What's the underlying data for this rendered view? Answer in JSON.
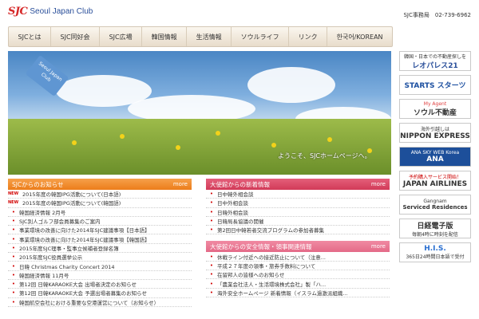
{
  "header": {
    "logo_mark": "SJC",
    "logo_text": "Seoul Japan Club",
    "office_label": "SJC事務局　02-739-6962"
  },
  "nav": {
    "items": [
      "SJCとは",
      "SJC同好会",
      "SJC広場",
      "韓国情報",
      "生活情報",
      "ソウルライフ",
      "リンク",
      "한국어/KOREAN"
    ]
  },
  "hero": {
    "tag_text": "Seoul Japan Club",
    "welcome_text": "ようこそ、SJCホームページへ。"
  },
  "sidebar": {
    "banners": [
      {
        "top": "韓国・日本での不動産探しを",
        "main": "レオパレス21"
      },
      {
        "top": "",
        "main": "STARTS スターツ"
      },
      {
        "top": "My Agent",
        "main": "ソウル不動産"
      },
      {
        "top": "海外引越しは",
        "main": "NIPPON EXPRESS"
      },
      {
        "top": "ANA SKY WEB Korea",
        "main": "ANA"
      },
      {
        "top": "予約購入サービス開始！",
        "main": "JAPAN AIRLINES"
      },
      {
        "top": "Gangnam",
        "main": "Serviced Residences"
      },
      {
        "top": "毎朝4時に時刻を配信",
        "main": "日経電子版"
      },
      {
        "top": "365日24時間日本語で受付",
        "main": "H.I.S."
      }
    ]
  },
  "sjc_news": {
    "title": "SJCからのお知らせ",
    "more": "more",
    "items": [
      {
        "new": "NEW",
        "text": "2015年度の韓国IPG活動について(日本語)"
      },
      {
        "new": "NEW",
        "text": "2015年度の韓国IPG活動について(韓国語)"
      },
      {
        "new": "",
        "text": "韓国経済情報 2月号"
      },
      {
        "new": "",
        "text": "SJC別人ゴルフ部会員募集のご案内"
      },
      {
        "new": "",
        "text": "事業環境の改善に向けた2014年SJC建議事項【日本語】"
      },
      {
        "new": "",
        "text": "事業環境の改善に向けた2014年SJC建議事項【韓国語】"
      },
      {
        "new": "",
        "text": "2015年度SJC理事・監事立候補者登録名簿"
      },
      {
        "new": "",
        "text": "2015年度SJC役員選挙公示"
      },
      {
        "new": "",
        "text": "日韓 Christmas Charity Concert 2014"
      },
      {
        "new": "",
        "text": "韓国経済情報 11月号"
      },
      {
        "new": "",
        "text": "第12回 日韓KARAOKE大会 出場者決定のお知らせ"
      },
      {
        "new": "",
        "text": "第12回 日韓KARAOKE大会 予選出場者募集のお知らせ"
      },
      {
        "new": "",
        "text": "韓国航空会社における重要な空港運営について（お知らせ）"
      }
    ]
  },
  "embassy_news": {
    "title": "大使館からの新着情報",
    "more": "more",
    "items": [
      {
        "text": "日中韓外相会談"
      },
      {
        "text": "日中外相会談"
      },
      {
        "text": "日韓外相会談"
      },
      {
        "text": "日韓局長協議の開催"
      },
      {
        "text": "第2回日中韓若者交流プログラムの参加者募集"
      }
    ]
  },
  "safety_news": {
    "title": "大使館からの安全情報・領事関連情報",
    "more": "more",
    "items": [
      {
        "text": "休戦ライン付近への接近防止について（注意..."
      },
      {
        "text": "平成２７年度の領事・旅券手数料について"
      },
      {
        "text": "在留邦人の皆様へのお知らせ"
      },
      {
        "text": "「農業会社法人・生活環境株式会社」製「ハ..."
      },
      {
        "text": "海外安全ホームページ 新着情報（イスラム過激派組織..."
      }
    ]
  }
}
